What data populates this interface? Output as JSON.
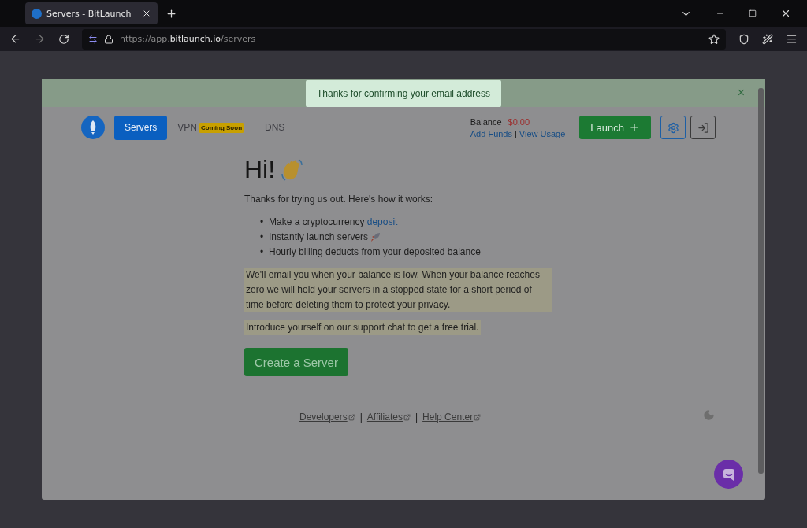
{
  "browser": {
    "tabs": [
      {
        "title": "Servers - BitLaunch",
        "selected": true
      }
    ],
    "url": {
      "before": "https://app.",
      "domain": "bitlaunch.io",
      "after": "/servers"
    }
  },
  "alert": {
    "message": "Thanks for confirming your email address",
    "close": "×"
  },
  "nav": {
    "items": [
      {
        "label": "Servers",
        "selected": true
      },
      {
        "label": "VPN",
        "selected": false,
        "badge": "Coming Soon"
      },
      {
        "label": "DNS",
        "selected": false
      }
    ]
  },
  "balance": {
    "label": "Balance",
    "amount": "$0.00",
    "links": [
      "Add Funds",
      "View Usage"
    ],
    "separator": "|"
  },
  "launch_button": "Launch",
  "welcome": {
    "heading": "Hi!",
    "intro": "Thanks for trying us out. Here's how it works:",
    "bullets": [
      {
        "marker": "•",
        "kind": "link",
        "text": "Make a cryptocurrency ",
        "link": "deposit"
      },
      {
        "marker": "•",
        "kind": "emoji",
        "text": "Instantly launch servers"
      },
      {
        "marker": "•",
        "kind": "plain",
        "text": "Hourly billing deducts from your deposited balance"
      }
    ],
    "notes": [
      "We'll email you when your balance is low. When your balance reaches zero we will hold your servers in a stopped state for a short period of time before deleting them to protect your privacy.",
      "Introduce yourself on our support chat to get a free trial."
    ],
    "button": "Create a Server"
  },
  "footer": {
    "links": [
      "Developers",
      "Affiliates",
      "Help Center"
    ],
    "separator": "|"
  }
}
